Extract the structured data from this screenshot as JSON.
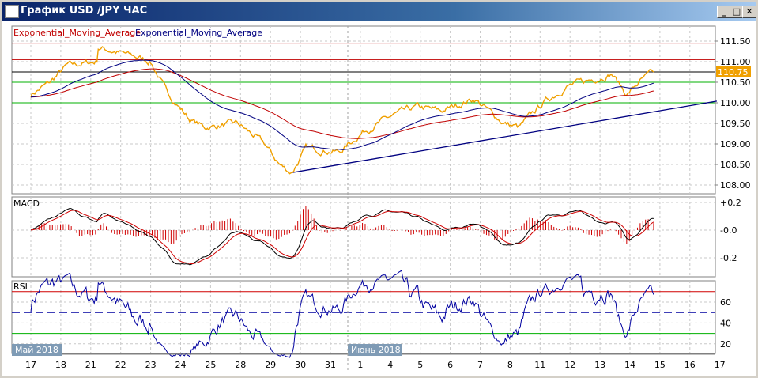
{
  "window": {
    "title": "График USD /JPY  ЧАС",
    "minimize": "_",
    "maximize": "□",
    "close": "✕"
  },
  "legend": {
    "ema1": "Exponential_Moving_Average",
    "ema2": "Exponential_Moving_Average",
    "ema1_color": "#c00000",
    "ema2_color": "#000080"
  },
  "colors": {
    "price": "#f0a000",
    "macd_hist": "#d00000",
    "rsi": "#0000a0"
  },
  "chart_data": [
    {
      "type": "line",
      "title": "USD/JPY H1",
      "ylabel": "",
      "ylim": [
        107.9,
        111.7
      ],
      "yticks": [
        "111.50",
        "111.00",
        "110.50",
        "110.00",
        "109.50",
        "109.00",
        "108.50",
        "108.00"
      ],
      "current_price": "110.75",
      "price_path": {
        "x": [
          0,
          0.65,
          1.2,
          2.2,
          2.25,
          3.6,
          4.0,
          4.5,
          5.3,
          5.8,
          6.9,
          7.8,
          8.3,
          8.7,
          9.2,
          10.3,
          11.1,
          12.1,
          12.9,
          13.7,
          14.8,
          15.8,
          16.3,
          17.1,
          17.9,
          18.9,
          19.4,
          19.9,
          20.3,
          20.8
        ],
        "y": [
          110.2,
          110.5,
          110.9,
          111.0,
          111.35,
          111.1,
          111.0,
          110.3,
          109.6,
          109.4,
          109.5,
          109.0,
          108.5,
          108.3,
          108.9,
          108.8,
          109.3,
          109.7,
          109.9,
          109.8,
          110.1,
          109.5,
          109.4,
          110.0,
          110.4,
          110.6,
          110.7,
          110.2,
          110.5,
          110.75
        ]
      },
      "levels": [
        {
          "value": 111.45,
          "color": "#c00000"
        },
        {
          "value": 111.05,
          "color": "#c00000"
        },
        {
          "value": 110.75,
          "color": "#000000"
        },
        {
          "value": 110.5,
          "color": "#00b000"
        },
        {
          "value": 110.0,
          "color": "#00b000"
        }
      ],
      "trendline": {
        "x": [
          8.7,
          22.9
        ],
        "y": [
          108.3,
          110.04
        ],
        "color": "#000080"
      }
    },
    {
      "type": "line",
      "title": "MACD",
      "ylim": [
        -0.3,
        0.25
      ],
      "yticks": [
        "+0.2",
        "-0.0",
        "-0.2"
      ]
    },
    {
      "type": "line",
      "title": "RSI",
      "ylim": [
        13,
        83
      ],
      "yticks": [
        "60",
        "40",
        "20"
      ],
      "levels": [
        70,
        50,
        30
      ]
    }
  ],
  "xaxis": {
    "months": [
      "Май 2018",
      "Июнь 2018"
    ],
    "ticks": [
      "17",
      "18",
      "21",
      "22",
      "23",
      "24",
      "25",
      "28",
      "29",
      "30",
      "31",
      "1",
      "4",
      "5",
      "6",
      "7",
      "8",
      "11",
      "12",
      "13",
      "14",
      "15",
      "16",
      "17"
    ]
  }
}
